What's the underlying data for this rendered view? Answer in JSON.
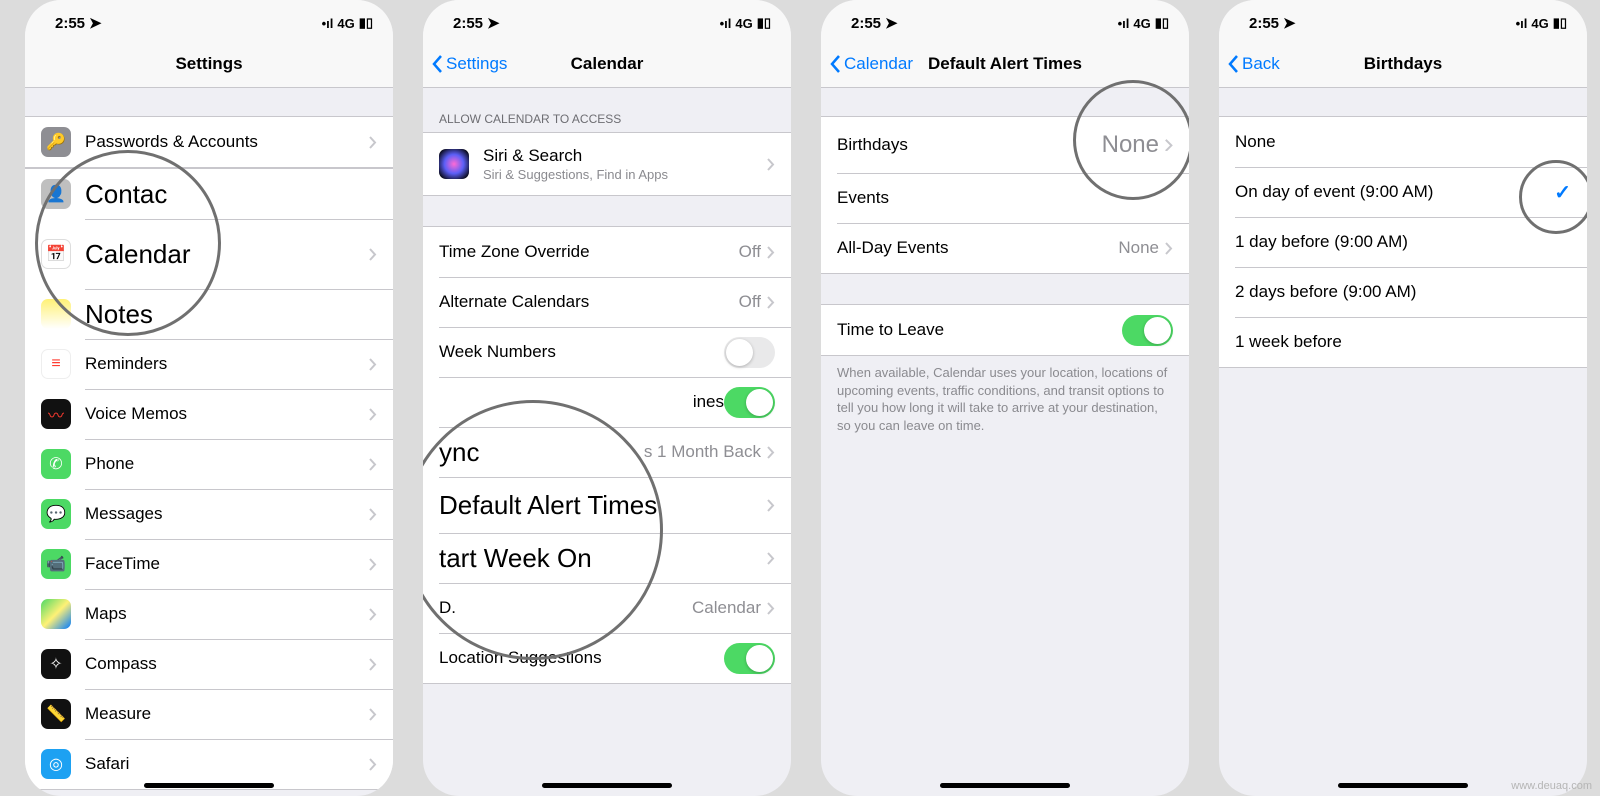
{
  "status": {
    "time": "2:55",
    "network": "4G"
  },
  "screens": [
    {
      "nav": {
        "title": "Settings",
        "back": null
      },
      "items": [
        {
          "label": "Passwords & Accounts",
          "iconColor": "#8e8e93"
        },
        {
          "label": "Contac",
          "large": true,
          "iconColor": "#b8b8b8",
          "hideChevron": true
        },
        {
          "label": "Calendar",
          "iconEmoji": "📅",
          "iconColor": "#fff",
          "large": true,
          "chev": true
        },
        {
          "label": "Notes",
          "large": true,
          "hideChevron": true
        },
        {
          "label": "Reminders",
          "iconColor": "#fff",
          "iconEmoji": "≡"
        },
        {
          "label": "Voice Memos",
          "iconColor": "#111",
          "iconEmoji": "〰"
        },
        {
          "label": "Phone",
          "iconColor": "#4cd964",
          "iconEmoji": "✆"
        },
        {
          "label": "Messages",
          "iconColor": "#4cd964",
          "iconEmoji": "✉"
        },
        {
          "label": "FaceTime",
          "iconColor": "#4cd964",
          "iconEmoji": "■"
        },
        {
          "label": "Maps",
          "iconColor": "#fff",
          "iconEmoji": "🗺"
        },
        {
          "label": "Compass",
          "iconColor": "#111",
          "iconEmoji": "✧"
        },
        {
          "label": "Measure",
          "iconColor": "#111",
          "iconEmoji": "📏"
        },
        {
          "label": "Safari",
          "iconColor": "#1da1f2",
          "iconEmoji": "◎"
        }
      ]
    },
    {
      "nav": {
        "title": "Calendar",
        "back": "Settings"
      },
      "sectionHeader": "ALLOW CALENDAR TO ACCESS",
      "siri": {
        "title": "Siri & Search",
        "sub": "Siri & Suggestions, Find in Apps"
      },
      "rows": [
        {
          "label": "Time Zone Override",
          "value": "Off"
        },
        {
          "label": "Alternate Calendars",
          "value": "Off"
        },
        {
          "label": "Week Numbers",
          "toggle": "off"
        },
        {
          "labelHidden": "ines",
          "toggle": "on"
        },
        {
          "label": "ync",
          "labelPartial": true,
          "value": "s 1 Month Back",
          "valuePartial": true
        },
        {
          "label": "Default Alert Times",
          "large": true
        },
        {
          "label": "tart Week On",
          "labelPartial": true
        },
        {
          "label": "D.",
          "value": "Calendar"
        },
        {
          "label": "Location Suggestions",
          "toggle": "on"
        }
      ]
    },
    {
      "nav": {
        "title": "Default Alert Times",
        "back": "Calendar"
      },
      "rows": [
        {
          "label": "Birthdays",
          "value": "None"
        },
        {
          "label": "Events"
        },
        {
          "label": "All-Day Events",
          "value": "None"
        }
      ],
      "timeToLeave": {
        "label": "Time to Leave",
        "toggle": "on"
      },
      "footer": "When available, Calendar uses your location, locations of upcoming events, traffic conditions, and transit options to tell you how long it will take to arrive at your destination, so you can leave on time."
    },
    {
      "nav": {
        "title": "Birthdays",
        "back": "Back"
      },
      "options": [
        {
          "label": "None",
          "selected": false
        },
        {
          "label": "On day of event (9:00 AM)",
          "selected": true
        },
        {
          "label": "1 day before (9:00 AM)",
          "selected": false
        },
        {
          "label": "2 days before (9:00 AM)",
          "selected": false
        },
        {
          "label": "1 week before",
          "selected": false
        }
      ]
    }
  ],
  "watermark": "www.deuaq.com"
}
